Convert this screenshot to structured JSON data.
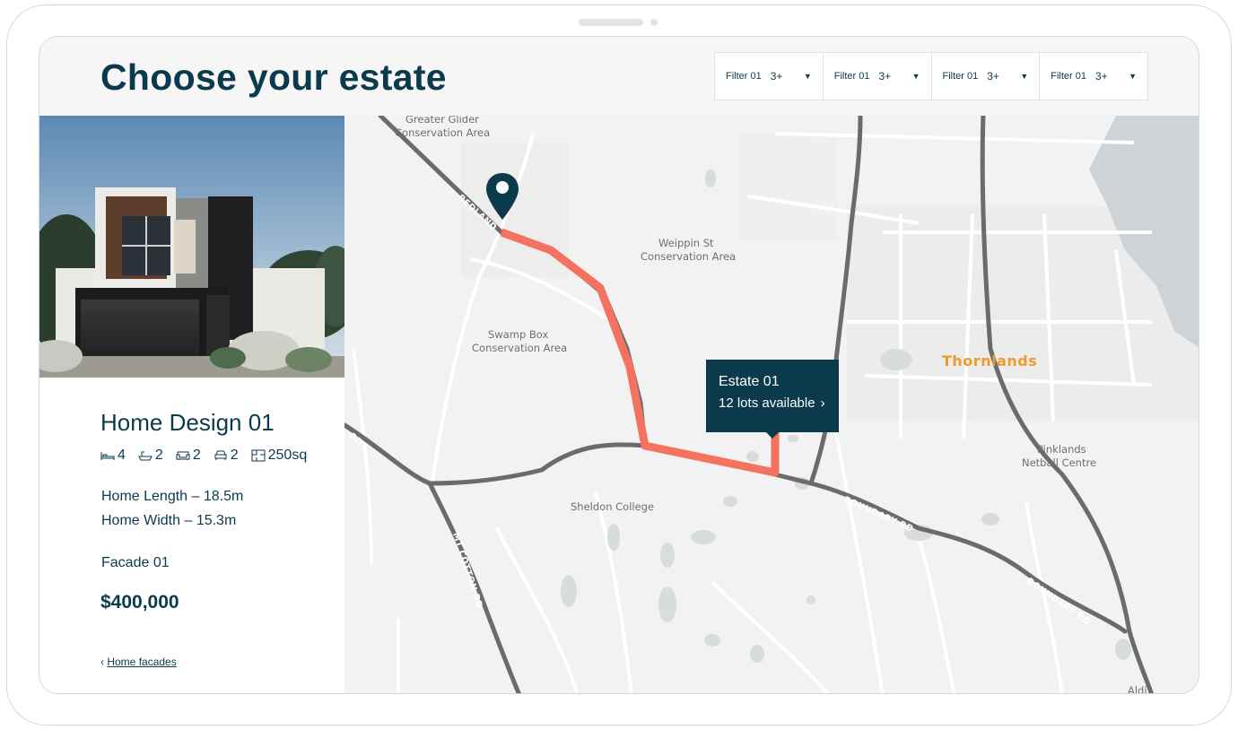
{
  "header": {
    "title": "Choose your estate"
  },
  "filters": [
    {
      "label": "Filter 01",
      "value": "3+",
      "icon": "caret-down-icon"
    },
    {
      "label": "Filter 01",
      "value": "3+",
      "icon": "caret-down-icon"
    },
    {
      "label": "Filter 01",
      "value": "3+",
      "icon": "caret-down-icon"
    },
    {
      "label": "Filter 01",
      "value": "3+",
      "icon": "caret-down-icon"
    }
  ],
  "home": {
    "name": "Home Design 01",
    "specs": [
      {
        "icon": "bed-icon",
        "value": "4"
      },
      {
        "icon": "bath-icon",
        "value": "2"
      },
      {
        "icon": "sofa-icon",
        "value": "2"
      },
      {
        "icon": "car-icon",
        "value": "2"
      },
      {
        "icon": "floorplan-icon",
        "value": "250sq"
      }
    ],
    "length": "Home Length – 18.5m",
    "width": "Home Width – 15.3m",
    "facade": "Facade 01",
    "price": "$400,000",
    "back_link": {
      "chevron": "‹",
      "label": "Home facades"
    }
  },
  "map": {
    "place_labels": {
      "greater_glider_1": "Greater Glider",
      "greater_glider_2": "Conservation Area",
      "weippin_1": "Weippin St",
      "weippin_2": "Conservation Area",
      "swamp_box_1": "Swamp Box",
      "swamp_box_2": "Conservation Area",
      "sheldon_college": "Sheldon College",
      "pinklands_1": "Pinklands",
      "pinklands_2": "Netball Centre",
      "aldi": "Aldi"
    },
    "suburb": "Thornlands",
    "streets": {
      "redland": "REDLAND",
      "boundary_1": "BOUNDARY RD",
      "boundary_2": "BOUNDARY RD",
      "mt_cotton": "MT COTTON RD",
      "rd_left": "RD"
    },
    "route_color": "#f47260",
    "road_color": "#6b6b6e",
    "estate": {
      "name": "Estate 01",
      "lots": "12 lots available",
      "chevron": "›"
    },
    "pin_icon": "map-pin-icon"
  },
  "colors": {
    "primary": "#0b3a4d",
    "route": "#f47260",
    "suburb": "#ef9a2e",
    "map_bg": "#f2f2f2",
    "water": "#cdd3d6"
  }
}
